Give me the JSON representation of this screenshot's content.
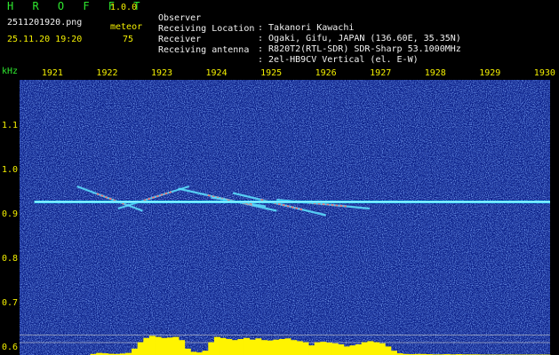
{
  "app": {
    "title": "H R O F F T",
    "version": "1.0.0"
  },
  "file": "2511201920.png",
  "datetime": "25.11.20 19:20",
  "meteor": {
    "label": "meteor",
    "count": "75"
  },
  "info": [
    {
      "label": "Observer",
      "value": ": Takanori Kawachi"
    },
    {
      "label": "Receiving Location",
      "value": ": Ogaki, Gifu, JAPAN (136.60E, 35.35N)"
    },
    {
      "label": "Receiver",
      "value": ": R820T2(RTL-SDR) SDR-Sharp 53.1000MHz"
    },
    {
      "label": "Receiving antenna",
      "value": ": 2el-HB9CV Vertical (el. E-W)"
    }
  ],
  "colors": {
    "background": "#000000",
    "spectrogram": "#0a1e86",
    "trace": "#29d8ff",
    "meteor_core": "#ff6a6a",
    "bottom_bar": "#fff400"
  },
  "chart_data": {
    "type": "heatmap",
    "xlabel": "",
    "ylabel": "kHz",
    "x_ticks": [
      "1921",
      "1922",
      "1923",
      "1924",
      "1925",
      "1926",
      "1927",
      "1928",
      "1929",
      "1930"
    ],
    "y_ticks": [
      "1.1",
      "1.0",
      "0.9",
      "0.8",
      "0.7",
      "0.6"
    ],
    "y_tick_values": [
      1.1,
      1.0,
      0.9,
      0.8,
      0.7,
      0.6
    ],
    "ylim": [
      0.58,
      1.2
    ],
    "xlim": [
      1920.4,
      1930.1
    ],
    "carrier": {
      "start": 1920.67,
      "end": 1930.1,
      "freq": 0.925
    },
    "meteors": [
      {
        "start": 1921.45,
        "end": 1922.65,
        "f0": 0.96,
        "f1": 0.905
      },
      {
        "start": 1922.2,
        "end": 1923.5,
        "f0": 0.91,
        "f1": 0.96
      },
      {
        "start": 1923.3,
        "end": 1925.1,
        "f0": 0.955,
        "f1": 0.905
      },
      {
        "start": 1924.3,
        "end": 1926.0,
        "f0": 0.945,
        "f1": 0.895
      },
      {
        "start": 1923.9,
        "end": 1924.9,
        "f0": 0.935,
        "f1": 0.915
      },
      {
        "start": 1925.1,
        "end": 1926.8,
        "f0": 0.93,
        "f1": 0.91
      }
    ],
    "bottom_bar": [
      0.0,
      0.0,
      0.0,
      0.0,
      0.0,
      0.0,
      0.0,
      0.0,
      0.0,
      0.0,
      0.0,
      0.0,
      0.05,
      0.1,
      0.08,
      0.06,
      0.05,
      0.07,
      0.1,
      0.3,
      0.6,
      0.8,
      0.9,
      0.85,
      0.8,
      0.82,
      0.85,
      0.7,
      0.3,
      0.15,
      0.12,
      0.2,
      0.6,
      0.85,
      0.8,
      0.75,
      0.7,
      0.75,
      0.8,
      0.72,
      0.78,
      0.7,
      0.68,
      0.72,
      0.75,
      0.78,
      0.7,
      0.65,
      0.6,
      0.45,
      0.6,
      0.62,
      0.58,
      0.55,
      0.5,
      0.4,
      0.45,
      0.5,
      0.6,
      0.65,
      0.6,
      0.55,
      0.4,
      0.2,
      0.08,
      0.05,
      0.04,
      0.05,
      0.05,
      0.04,
      0.03,
      0.03,
      0.04,
      0.03,
      0.04,
      0.03,
      0.03,
      0.03,
      0.02,
      0.02,
      0.02,
      0.02,
      0.02,
      0.02,
      0.02,
      0.02,
      0.02,
      0.02,
      0.02,
      0.02
    ]
  }
}
